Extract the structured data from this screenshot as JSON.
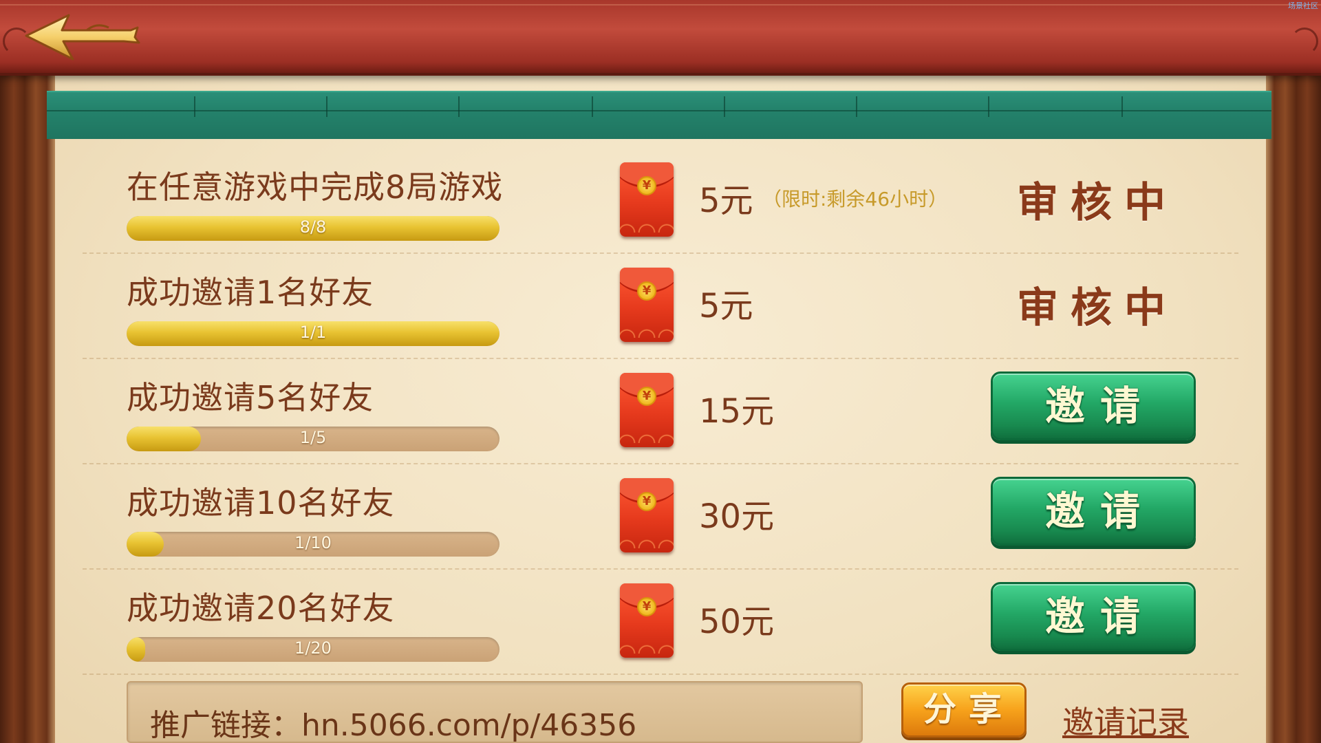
{
  "header": {
    "back_icon": "back-arrow-icon",
    "site_mark": "场景社区",
    "bg_color": "#b8402f"
  },
  "tasks": [
    {
      "title": "在任意游戏中完成8局游戏",
      "progress_text": "8/8",
      "progress_ratio": 1.0,
      "reward": "5元",
      "limit_note": "（限时:剩余46小时）",
      "status": "审核中",
      "action_label": ""
    },
    {
      "title": "成功邀请1名好友",
      "progress_text": "1/1",
      "progress_ratio": 1.0,
      "reward": "5元",
      "limit_note": "",
      "status": "审核中",
      "action_label": ""
    },
    {
      "title": "成功邀请5名好友",
      "progress_text": "1/5",
      "progress_ratio": 0.2,
      "reward": "15元",
      "limit_note": "",
      "status": "",
      "action_label": "邀请"
    },
    {
      "title": "成功邀请10名好友",
      "progress_text": "1/10",
      "progress_ratio": 0.1,
      "reward": "30元",
      "limit_note": "",
      "status": "",
      "action_label": "邀请"
    },
    {
      "title": "成功邀请20名好友",
      "progress_text": "1/20",
      "progress_ratio": 0.05,
      "reward": "50元",
      "limit_note": "",
      "status": "",
      "action_label": "邀请"
    }
  ],
  "footer": {
    "link_label": "推广链接：hn.5066.com/p/46356",
    "share_label": "分享",
    "record_label": "邀请记录"
  },
  "colors": {
    "accent_green": "#23a866",
    "accent_gold": "#e8c332",
    "text_brown": "#7a3a1c"
  }
}
